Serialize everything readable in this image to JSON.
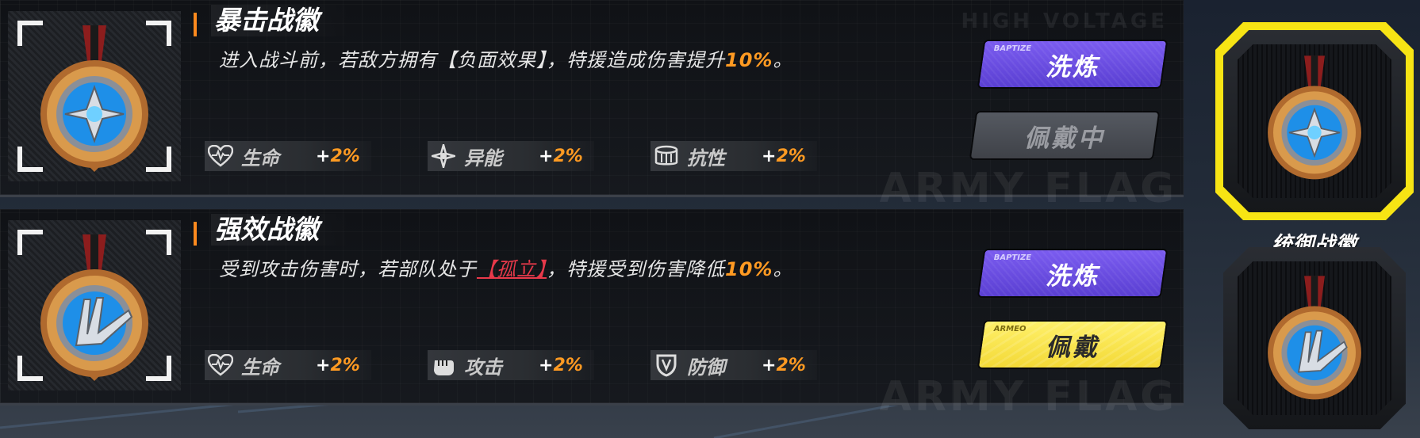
{
  "cards": [
    {
      "title": "暴击战徽",
      "desc_pre": "进入战斗前，若敌方拥有【负面效果】，特援造成伤害提升",
      "desc_tag": "",
      "desc_post": "",
      "desc_pct": "10%",
      "desc_end": "。",
      "stats": [
        {
          "name": "生命",
          "plus": "+",
          "value": "2%",
          "icon": "heart-pulse-icon"
        },
        {
          "name": "异能",
          "plus": "+",
          "value": "2%",
          "icon": "energy-burst-icon"
        },
        {
          "name": "抗性",
          "plus": "+",
          "value": "2%",
          "icon": "resistance-drum-icon"
        }
      ],
      "buttons": {
        "baptize_sub": "BAPTIZE",
        "baptize_label": "洗炼",
        "equip_label": "佩戴中"
      }
    },
    {
      "title": "强效战徽",
      "desc_pre": "受到攻击伤害时，若部队处于",
      "desc_tag": "【孤立】",
      "desc_post": "，特援受到伤害降低",
      "desc_pct": "10%",
      "desc_end": "。",
      "stats": [
        {
          "name": "生命",
          "plus": "+",
          "value": "2%",
          "icon": "heart-pulse-icon"
        },
        {
          "name": "攻击",
          "plus": "+",
          "value": "2%",
          "icon": "fist-icon"
        },
        {
          "name": "防御",
          "plus": "+",
          "value": "2%",
          "icon": "shield-icon"
        }
      ],
      "buttons": {
        "baptize_sub": "BAPTIZE",
        "baptize_label": "洗炼",
        "equip_sub": "ARMEO",
        "equip_label": "佩戴"
      }
    }
  ],
  "watermarks": {
    "top": "HIGH VOLTAGE",
    "bottom": "ARMY FLAG"
  },
  "side_slots": {
    "label": "统御战徽"
  },
  "colors": {
    "accent_orange": "#ff9a22",
    "select_yellow": "#f7e414",
    "button_purple": "#6a4ce2",
    "button_yellow": "#f6e04a",
    "tag_red": "#e8394a"
  }
}
